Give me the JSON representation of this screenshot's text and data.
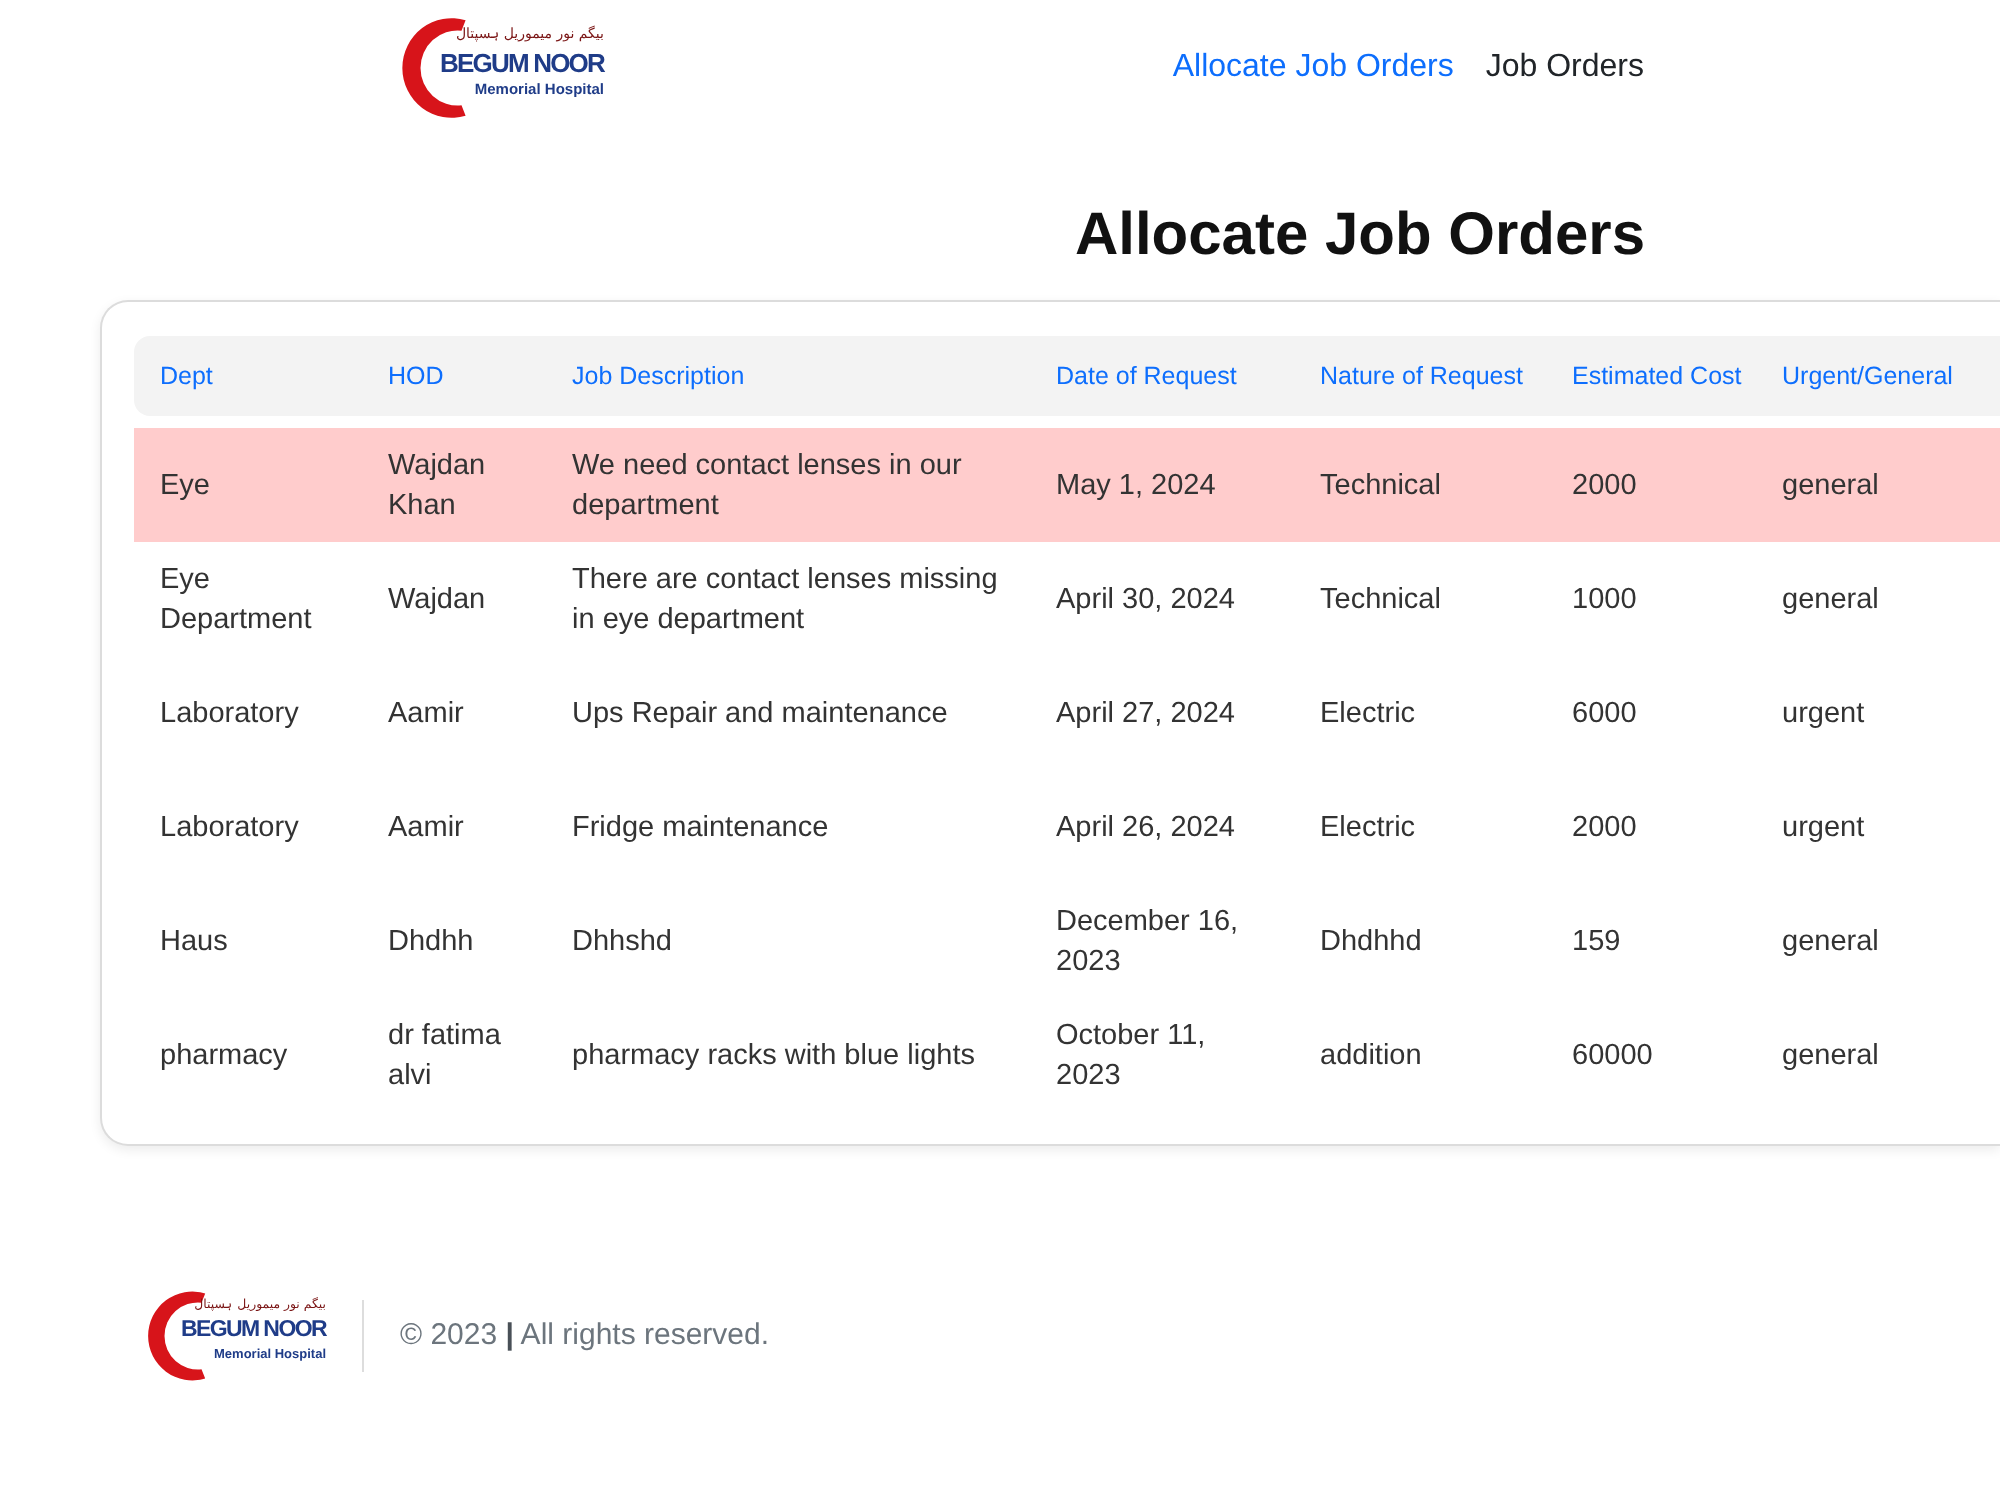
{
  "header": {
    "logo": {
      "urdu": "بیگم نور میموریل ہسپتال",
      "name": "BEGUM NOOR",
      "subtitle": "Memorial Hospital"
    },
    "nav": [
      {
        "label": "Allocate Job Orders",
        "selected": true
      },
      {
        "label": "Job Orders",
        "selected": false
      }
    ]
  },
  "page_title": "Allocate Job Orders",
  "table": {
    "columns": [
      "Dept",
      "HOD",
      "Job Description",
      "Date of Request",
      "Nature of Request",
      "Estimated Cost",
      "Urgent/General"
    ],
    "rows": [
      {
        "selected": true,
        "cells": [
          "Eye",
          "Wajdan Khan",
          "We need contact lenses in our department",
          "May 1, 2024",
          "Technical",
          "2000",
          "general"
        ]
      },
      {
        "selected": false,
        "cells": [
          "Eye Department",
          "Wajdan",
          "There are contact lenses missing in eye department",
          "April 30, 2024",
          "Technical",
          "1000",
          "general"
        ]
      },
      {
        "selected": false,
        "cells": [
          "Laboratory",
          "Aamir",
          "Ups Repair and maintenance",
          "April 27, 2024",
          "Electric",
          "6000",
          "urgent"
        ]
      },
      {
        "selected": false,
        "cells": [
          "Laboratory",
          "Aamir",
          "Fridge maintenance",
          "April 26, 2024",
          "Electric",
          "2000",
          "urgent"
        ]
      },
      {
        "selected": false,
        "cells": [
          "Haus",
          "Dhdhh",
          "Dhhshd",
          "December 16, 2023",
          "Dhdhhd",
          "159",
          "general"
        ]
      },
      {
        "selected": false,
        "cells": [
          "pharmacy",
          "dr fatima alvi",
          "pharmacy racks with blue lights",
          "October 11, 2023",
          "addition",
          "60000",
          "general"
        ]
      }
    ]
  },
  "footer": {
    "logo": {
      "urdu": "بیگم نور میموریل ہسپتال",
      "name": "BEGUM NOOR",
      "subtitle": "Memorial Hospital"
    },
    "copyright": "© 2023 **|** All rights reserved."
  }
}
